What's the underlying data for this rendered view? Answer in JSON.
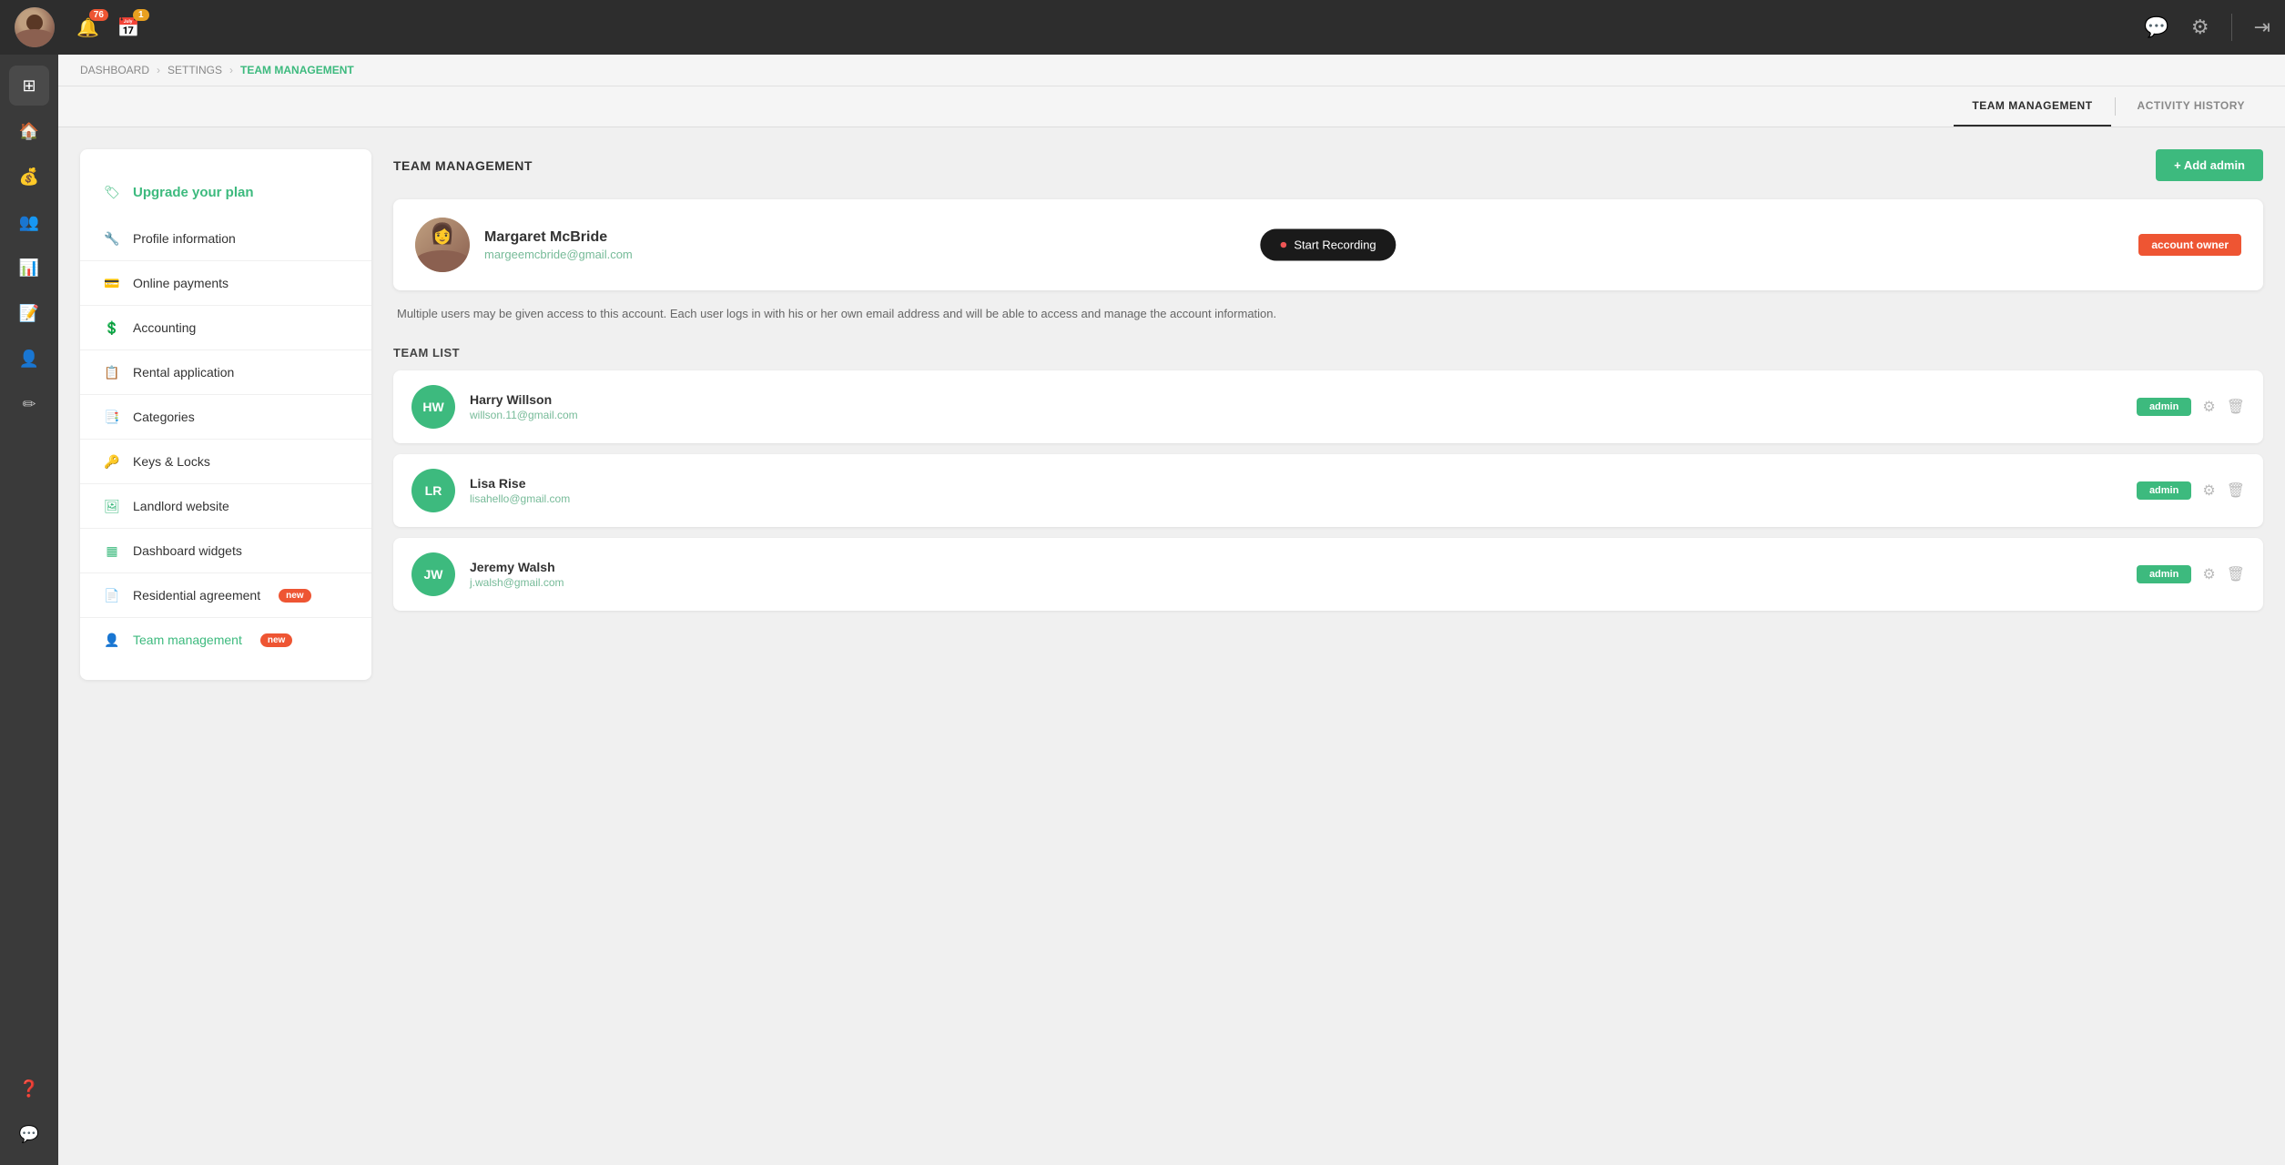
{
  "header": {
    "notification_count": "76",
    "calendar_count": "1",
    "chat_icon": "💬",
    "settings_icon": "⚙",
    "logout_icon": "→"
  },
  "breadcrumb": {
    "items": [
      "DASHBOARD",
      "SETTINGS",
      "TEAM MANAGEMENT"
    ],
    "current": "TEAM MANAGEMENT"
  },
  "tabs": [
    {
      "label": "TEAM MANAGEMENT",
      "active": true
    },
    {
      "label": "ACTIVITY HISTORY",
      "active": false
    }
  ],
  "sidebar": {
    "upgrade_label": "Upgrade your plan",
    "items": [
      {
        "label": "Profile information",
        "icon": "🔧"
      },
      {
        "label": "Online payments",
        "icon": "💳"
      },
      {
        "label": "Accounting",
        "icon": "💲"
      },
      {
        "label": "Rental application",
        "icon": "📋"
      },
      {
        "label": "Categories",
        "icon": "📑"
      },
      {
        "label": "Keys & Locks",
        "icon": "🔑"
      },
      {
        "label": "Landlord website",
        "icon": "🖼"
      },
      {
        "label": "Dashboard widgets",
        "icon": "▦"
      },
      {
        "label": "Residential agreement",
        "icon": "📄",
        "badge": "new"
      },
      {
        "label": "Team management",
        "icon": "👤",
        "badge": "new",
        "active": true
      }
    ]
  },
  "panel": {
    "title": "TEAM MANAGEMENT",
    "add_admin_label": "+ Add admin",
    "owner": {
      "name": "Margaret McBride",
      "email": "margeemcbride@gmail.com",
      "badge": "account owner"
    },
    "info_text": "Multiple users may be given access to this account. Each user logs in with his or her own email address and will be able to access and manage the account information.",
    "team_list_title": "TEAM LIST",
    "team_members": [
      {
        "initials": "HW",
        "name": "Harry Willson",
        "email": "willson.11@gmail.com",
        "role": "admin"
      },
      {
        "initials": "LR",
        "name": "Lisa Rise",
        "email": "lisahello@gmail.com",
        "role": "admin"
      },
      {
        "initials": "JW",
        "name": "Jeremy Walsh",
        "email": "j.walsh@gmail.com",
        "role": "admin"
      }
    ]
  },
  "recording_tooltip": "Start Recording",
  "icon_sidebar": [
    {
      "icon": "⊞",
      "label": "grid-icon"
    },
    {
      "icon": "🏠",
      "label": "home-icon"
    },
    {
      "icon": "💰",
      "label": "money-icon"
    },
    {
      "icon": "👥",
      "label": "people-icon"
    },
    {
      "icon": "📊",
      "label": "chart-icon"
    },
    {
      "icon": "📝",
      "label": "document-icon"
    },
    {
      "icon": "👤",
      "label": "contact-icon"
    },
    {
      "icon": "✏",
      "label": "edit-icon"
    },
    {
      "icon": "❓",
      "label": "help-icon"
    },
    {
      "icon": "💬",
      "label": "chat-icon"
    }
  ]
}
